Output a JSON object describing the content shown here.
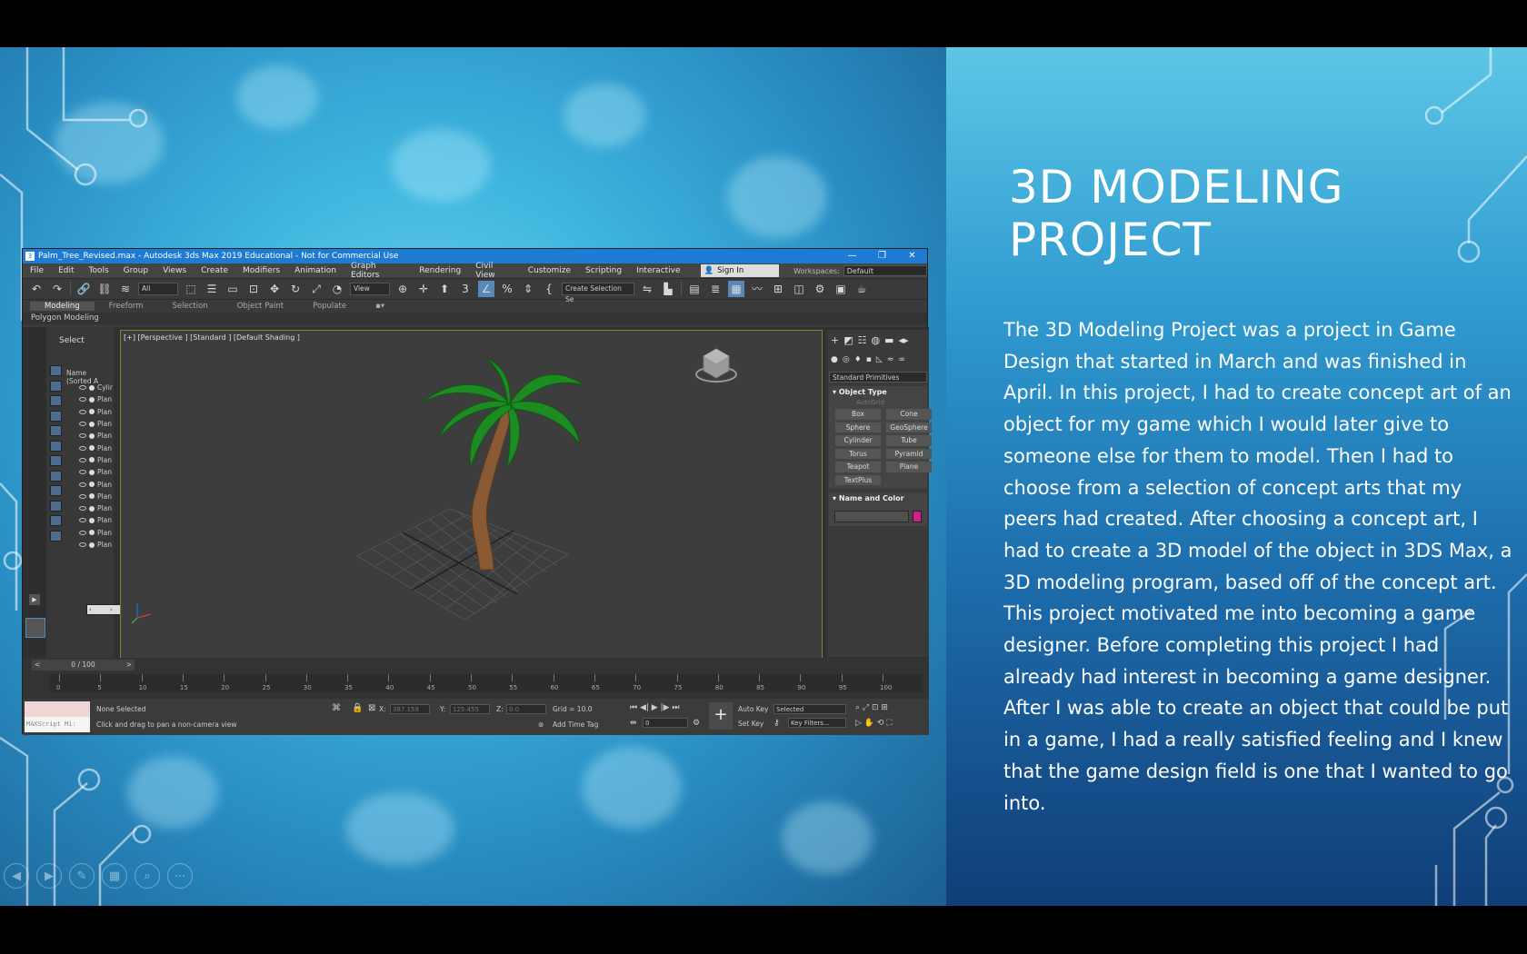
{
  "slide": {
    "title_line1": "3D MODELING",
    "title_line2": "PROJECT",
    "body": "The 3D Modeling Project was a project in Game Design that started in March and was finished in April. In this project, I had to create concept art of an object for my game which I would later give to someone else for them to model. Then I had to choose from a selection of concept arts that my peers had created. After choosing a concept art, I had to create a 3D model of the object in 3DS Max, a 3D modeling program, based off of the concept art. This project motivated me into becoming a game designer. Before completing this project I had already had interest in becoming a game designer. After I was able to create an object that could be put in a game, I had a really satisfied feeling and I knew that the game design field is one that I wanted to go into."
  },
  "app": {
    "window_title": "Palm_Tree_Revised.max - Autodesk 3ds Max 2019 Educational - Not for Commercial Use",
    "menus": [
      "File",
      "Edit",
      "Tools",
      "Group",
      "Views",
      "Create",
      "Modifiers",
      "Animation",
      "Graph Editors",
      "Rendering",
      "Civil View",
      "Customize",
      "Scripting",
      "Interactive"
    ],
    "sign_in": "Sign In",
    "workspaces_label": "Workspaces:",
    "workspace": "Default",
    "toolbar": {
      "filter": "All",
      "view": "View",
      "selection_set": "Create Selection Se"
    },
    "ribbon_tabs": [
      "Modeling",
      "Freeform",
      "Selection",
      "Object Paint",
      "Populate"
    ],
    "ribbon_sub": "Polygon Modeling",
    "scene": {
      "select_label": "Select",
      "header": "Name (Sorted A",
      "items": [
        "Cylir",
        "Plan",
        "Plan",
        "Plan",
        "Plan",
        "Plan",
        "Plan",
        "Plan",
        "Plan",
        "Plan",
        "Plan",
        "Plan",
        "Plan",
        "Plan"
      ]
    },
    "viewport_label": "[+] [Perspective ] [Standard ] [Default Shading ]",
    "command_panel": {
      "category": "Standard Primitives",
      "object_type": "Object Type",
      "autogrid": "AutoGrid",
      "primitives": [
        "Box",
        "Cone",
        "Sphere",
        "GeoSphere",
        "Cylinder",
        "Tube",
        "Torus",
        "Pyramid",
        "Teapot",
        "Plane",
        "TextPlus"
      ],
      "name_and_color": "Name and Color",
      "object_color": "#d11f8a"
    },
    "timeline": {
      "frame": "0 / 100",
      "ticks": [
        "0",
        "5",
        "10",
        "15",
        "20",
        "25",
        "30",
        "35",
        "40",
        "45",
        "50",
        "55",
        "60",
        "65",
        "70",
        "75",
        "80",
        "85",
        "90",
        "95",
        "100"
      ]
    },
    "status": {
      "maxscript": "MAXScript Mi:",
      "selection": "None Selected",
      "prompt": "Click and drag to pan a non-camera view",
      "x_label": "X:",
      "x_value": "387.158",
      "y_label": "Y:",
      "y_value": "125.455",
      "z_label": "Z:",
      "z_value": "0.0",
      "grid": "Grid = 10.0",
      "add_time_tag": "Add Time Tag",
      "auto_key": "Auto Key",
      "set_key": "Set Key",
      "key_mode": "Selected",
      "key_filters": "Key Filters...",
      "current_frame": "0"
    }
  }
}
